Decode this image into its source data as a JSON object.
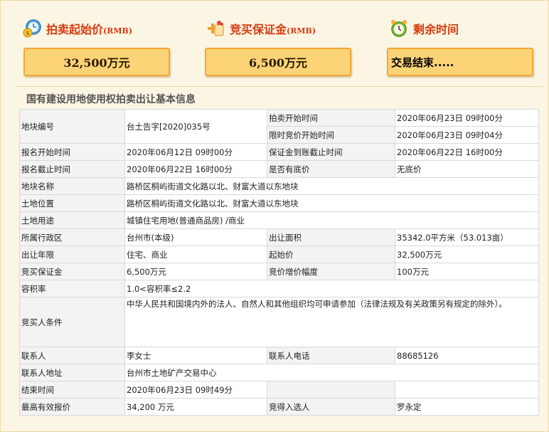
{
  "header": {
    "start_price_label": "拍卖起始价",
    "start_price_unit": "(RMB)",
    "start_price_value": "32,500万元",
    "deposit_label": "竞买保证金",
    "deposit_unit": "(RMB)",
    "deposit_value": "6,500万元",
    "remaining_label": "剩余时间",
    "remaining_value": "交易结束....."
  },
  "section_title": "国有建设用地使用权拍卖出让基本信息",
  "info": {
    "parcel_no_label": "地块编号",
    "parcel_no": "台土告字[2020]035号",
    "auction_start_label": "拍卖开始时间",
    "auction_start": "2020年06月23日 09时00分",
    "bid_start_label": "限时竞价开始时间",
    "bid_start": "2020年06月23日 09时04分",
    "reg_start_label": "报名开始时间",
    "reg_start": "2020年06月12日 09时00分",
    "deposit_deadline_label": "保证金到账截止时间",
    "deposit_deadline": "2020年06月22日 16时00分",
    "reg_end_label": "报名截止时间",
    "reg_end": "2020年06月22日 16时00分",
    "reserve_label": "是否有底价",
    "reserve": "无底价",
    "name_label": "地块名称",
    "name": "路桥区桐屿街道文化路以北、财富大道以东地块",
    "location_label": "土地位置",
    "location": "路桥区桐屿街道文化路以北、财富大道以东地块",
    "usage_label": "土地用途",
    "usage": "城镇住宅用地(普通商品房) /商业",
    "district_label": "所属行政区",
    "district": "台州市(本级)",
    "area_label": "出让面积",
    "area": "35342.0平方米（53.013亩）",
    "term_label": "出让年限",
    "term": "住宅、商业",
    "start_price_label": "起始价",
    "start_price": "32,500万元",
    "deposit_label": "竞买保证金",
    "deposit": "6,500万元",
    "increment_label": "竞价增价幅度",
    "increment": "100万元",
    "far_label": "容积率",
    "far": "1.0<容积率≤2.2",
    "conditions_label": "竞买人条件",
    "conditions": "中华人民共和国境内外的法人、自然人和其他组织均可申请参加（法律法规及有关政策另有规定的除外）。",
    "contact_label": "联系人",
    "contact": "李女士",
    "phone_label": "联系人电话",
    "phone": "88685126",
    "address_label": "联系人地址",
    "address": "台州市土地矿产交易中心",
    "end_time_label": "结束时间",
    "end_time": "2020年06月23日 09时49分",
    "top_bid_label": "最高有效报价",
    "top_bid": "34,200 万元",
    "winner_label": "竞得入选人",
    "winner": "罗永定"
  }
}
